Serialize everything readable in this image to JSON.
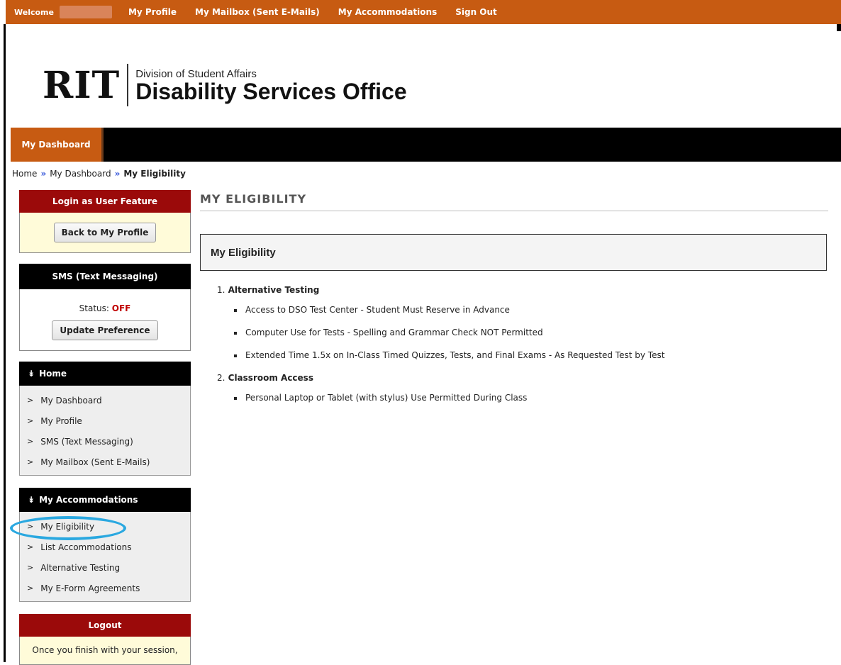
{
  "topbar": {
    "welcome": "Welcome",
    "links": [
      "My Profile",
      "My Mailbox (Sent E-Mails)",
      "My Accommodations",
      "Sign Out"
    ]
  },
  "header": {
    "logo_rit": "RIT",
    "division": "Division of Student Affairs",
    "office": "Disability Services Office"
  },
  "nav": {
    "tab": "My Dashboard"
  },
  "breadcrumb": {
    "home": "Home",
    "dashboard": "My Dashboard",
    "current": "My Eligibility"
  },
  "sidebar": {
    "login_box": {
      "title": "Login as User Feature",
      "button": "Back to My Profile"
    },
    "sms_box": {
      "title": "SMS (Text Messaging)",
      "status_label": "Status:",
      "status_value": "OFF",
      "button": "Update Preference"
    },
    "home_menu": {
      "title": "Home",
      "items": [
        "My Dashboard",
        "My Profile",
        "SMS (Text Messaging)",
        "My Mailbox (Sent E-Mails)"
      ]
    },
    "acc_menu": {
      "title": "My Accommodations",
      "items": [
        "My Eligibility",
        "List Accommodations",
        "Alternative Testing",
        "My E-Form Agreements"
      ]
    },
    "logout_box": {
      "title": "Logout",
      "text": "Once you finish with your session,"
    }
  },
  "main": {
    "title": "MY ELIGIBILITY",
    "panel_title": "My Eligibility",
    "categories": [
      {
        "num": "1.",
        "name": "Alternative Testing",
        "items": [
          "Access to DSO Test Center - Student Must Reserve in Advance",
          "Computer Use for Tests - Spelling and Grammar Check NOT Permitted",
          "Extended Time 1.5x on In-Class Timed Quizzes, Tests, and Final Exams - As Requested Test by Test"
        ]
      },
      {
        "num": "2.",
        "name": "Classroom Access",
        "items": [
          "Personal Laptop or Tablet (with stylus) Use Permitted During Class"
        ]
      }
    ]
  },
  "colors": {
    "brand_orange": "#c75b12",
    "header_red": "#9b0a0a",
    "status_off": "#c00000",
    "highlight": "#2aa8e0"
  }
}
